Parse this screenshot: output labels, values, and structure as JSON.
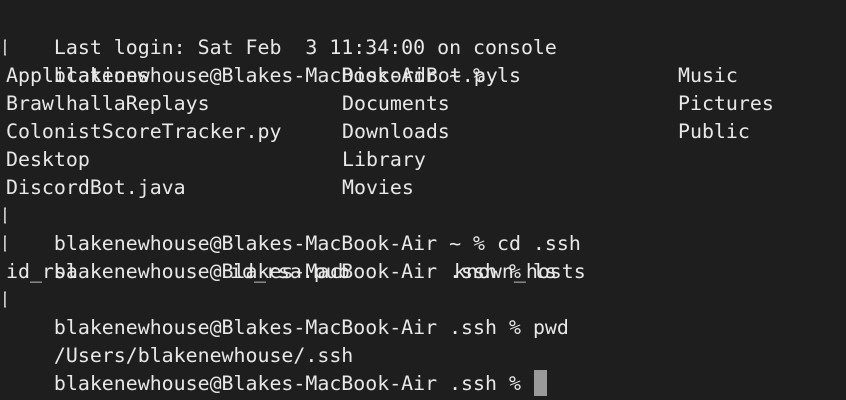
{
  "terminal": {
    "last_login": "Last login: Sat Feb  3 11:34:00 on console",
    "prompt_home": "blakenewhouse@Blakes-MacBook-Air ~ %",
    "prompt_ssh": "blakenewhouse@Blakes-MacBook-Air .ssh %",
    "cmd_ls": "ls",
    "cmd_cd": "cd .ssh",
    "cmd_pwd": "pwd",
    "ls_home_rows": [
      [
        "Applications",
        "DiscordBot.py",
        "Music"
      ],
      [
        "BrawlhallaReplays",
        "Documents",
        "Pictures"
      ],
      [
        "ColonistScoreTracker.py",
        "Downloads",
        "Public"
      ],
      [
        "Desktop",
        "Library",
        ""
      ],
      [
        "DiscordBot.java",
        "Movies",
        ""
      ]
    ],
    "ls_ssh_row": [
      "id_rsa",
      "id_rsa.pub",
      "known_hosts"
    ],
    "pwd_output": "/Users/blakenewhouse/.ssh",
    "line_marker": "["
  },
  "colors": {
    "background": "#1e1e1e",
    "text": "#e8e8e8",
    "cursor": "#9a9a9a"
  }
}
